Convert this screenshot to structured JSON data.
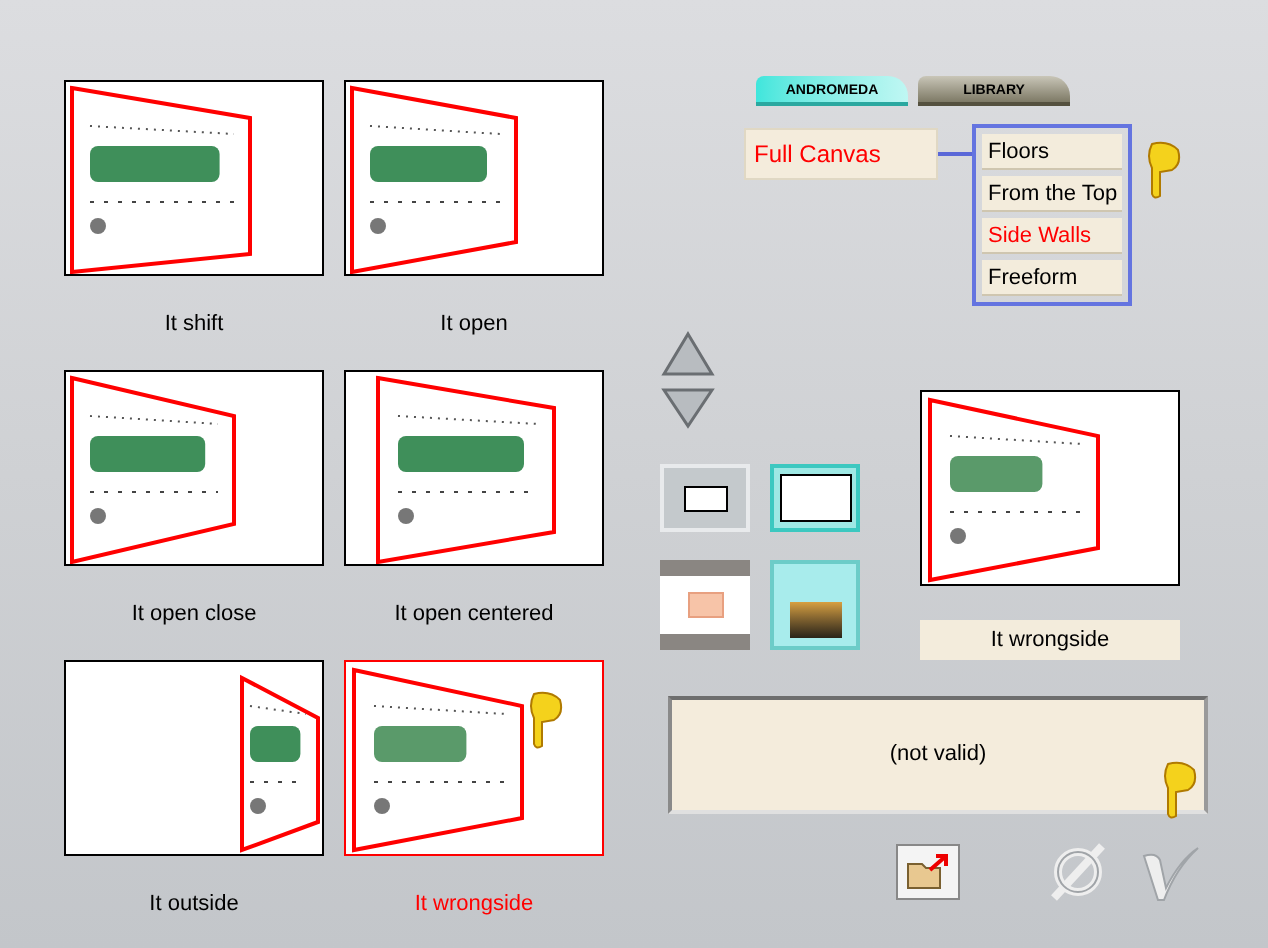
{
  "presets": [
    {
      "label": "It shift",
      "selected": false
    },
    {
      "label": "It open",
      "selected": false
    },
    {
      "label": "It open close",
      "selected": false
    },
    {
      "label": "It open centered",
      "selected": false
    },
    {
      "label": "It outside",
      "selected": false
    },
    {
      "label": "It wrongside",
      "selected": true
    }
  ],
  "tabs": [
    {
      "label": "ANDROMEDA",
      "selected": true
    },
    {
      "label": "LIBRARY",
      "selected": false
    }
  ],
  "category": {
    "label": "Full Canvas",
    "selected": true
  },
  "submenu": [
    {
      "label": "Floors",
      "selected": false
    },
    {
      "label": "From the Top",
      "selected": false
    },
    {
      "label": "Side Walls",
      "selected": true
    },
    {
      "label": "Freeform",
      "selected": false
    }
  ],
  "frame_buttons": [
    {
      "selected": false
    },
    {
      "selected": true
    }
  ],
  "preview": {
    "label": "It wrongside"
  },
  "message": "(not valid)"
}
